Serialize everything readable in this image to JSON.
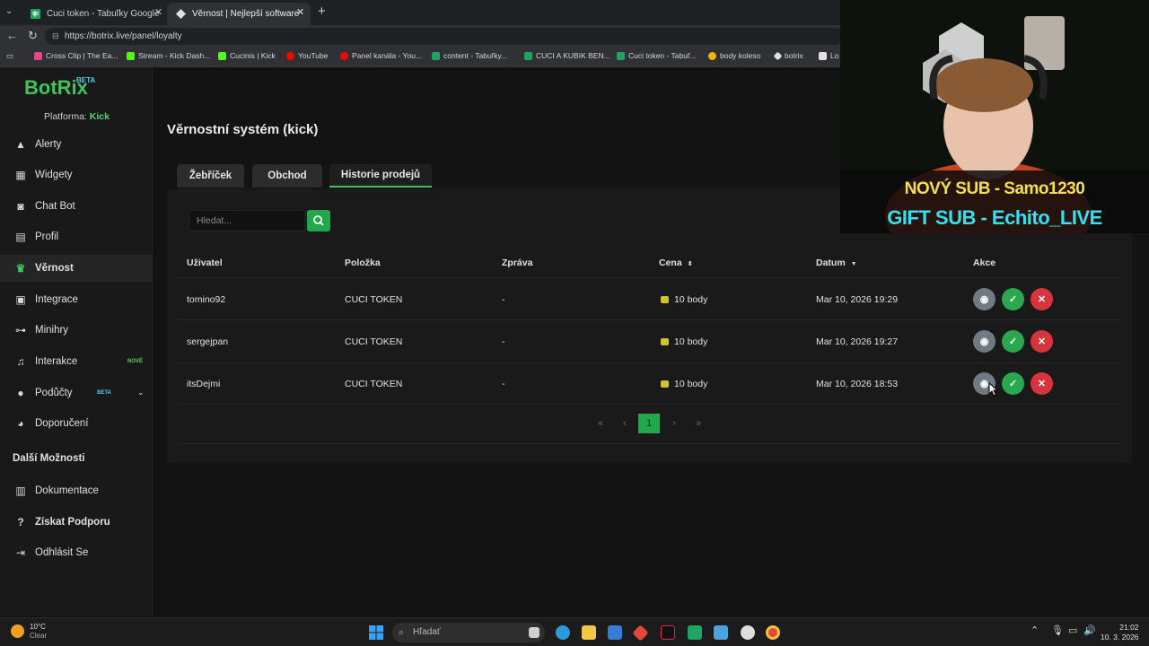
{
  "browser": {
    "tabs": [
      {
        "label": "Cuci token - Tabuľky Google",
        "icon": "sheets-icon",
        "active": false
      },
      {
        "label": "Věrnost | Nejlepší software pro vy...",
        "icon": "botrix-icon",
        "active": true
      }
    ],
    "url": "https://botrix.live/panel/loyalty",
    "bookmarks": [
      {
        "label": "Cross Clip | The Ea...",
        "color": "#e2478a"
      },
      {
        "label": "Stream - Kick Dash...",
        "color": "#53fc18"
      },
      {
        "label": "Cucinis | Kick",
        "color": "#53fc18"
      },
      {
        "label": "YouTube",
        "color": "#ff0000"
      },
      {
        "label": "Panel kanála - You...",
        "color": "#ff0000"
      },
      {
        "label": "content - Tabuľky...",
        "color": "#1fa463"
      },
      {
        "label": "CUCI A KUBIK BEN...",
        "color": "#1fa463"
      },
      {
        "label": "Cuci token - Tabuľ...",
        "color": "#1fa463"
      },
      {
        "label": "body koleso",
        "color": "#f4b400"
      },
      {
        "label": "botrix",
        "color": "#e0e0e0"
      },
      {
        "label": "Lo",
        "color": "#e0e0e0"
      }
    ]
  },
  "sidebar": {
    "logo": "BotRix",
    "logo_badge": "BETA",
    "platform_label": "Platforma:",
    "platform_value": "Kick",
    "items": [
      {
        "label": "Alerty",
        "icon": "warning-icon"
      },
      {
        "label": "Widgety",
        "icon": "widgets-icon"
      },
      {
        "label": "Chat Bot",
        "icon": "robot-icon"
      },
      {
        "label": "Profil",
        "icon": "profile-icon"
      },
      {
        "label": "Věrnost",
        "icon": "trophy-icon",
        "active": true
      },
      {
        "label": "Integrace",
        "icon": "integration-icon"
      },
      {
        "label": "Minihry",
        "icon": "gamepad-icon"
      },
      {
        "label": "Interakce",
        "icon": "music-icon",
        "badge": "NOVÉ"
      },
      {
        "label": "Podůčty",
        "icon": "users-icon",
        "badge": "BETA"
      },
      {
        "label": "Doporučení",
        "icon": "referral-icon"
      }
    ],
    "more_heading": "Další Možnosti",
    "more_items": [
      {
        "label": "Dokumentace",
        "icon": "docs-icon"
      },
      {
        "label": "Získat Podporu",
        "icon": "help-icon"
      },
      {
        "label": "Odhlásit Se",
        "icon": "logout-icon"
      }
    ]
  },
  "page": {
    "title": "Věrnostní systém (kick)",
    "tabs": [
      "Žebříček",
      "Obchod",
      "Historie prodejů"
    ],
    "active_tab": "Historie prodejů",
    "search_placeholder": "Hledat...",
    "columns": [
      "Uživatel",
      "Položka",
      "Zpráva",
      "Cena",
      "Datum",
      "Akce"
    ],
    "rows": [
      {
        "user": "tomino92",
        "item": "CUCI TOKEN",
        "message": "-",
        "price": "10 body",
        "date": "Mar 10, 2026 19:29"
      },
      {
        "user": "sergejpan",
        "item": "CUCI TOKEN",
        "message": "-",
        "price": "10 body",
        "date": "Mar 10, 2026 19:27"
      },
      {
        "user": "itsDejmi",
        "item": "CUCI TOKEN",
        "message": "-",
        "price": "10 body",
        "date": "Mar 10, 2026 18:53"
      }
    ],
    "pagination": {
      "first": "«",
      "prev": "‹",
      "current": "1",
      "next": "›",
      "last": "»"
    }
  },
  "overlay": {
    "new_sub": "NOVÝ SUB - Samo1230",
    "gift_sub": "GIFT SUB - Echito_LIVE"
  },
  "taskbar": {
    "temperature": "10°C",
    "weather": "Clear",
    "search_placeholder": "Hľadať",
    "time": "21:02",
    "date": "10. 3. 2026"
  },
  "colors": {
    "accent": "#3fc35a",
    "danger": "#d8343d",
    "view": "#6f7a82"
  }
}
